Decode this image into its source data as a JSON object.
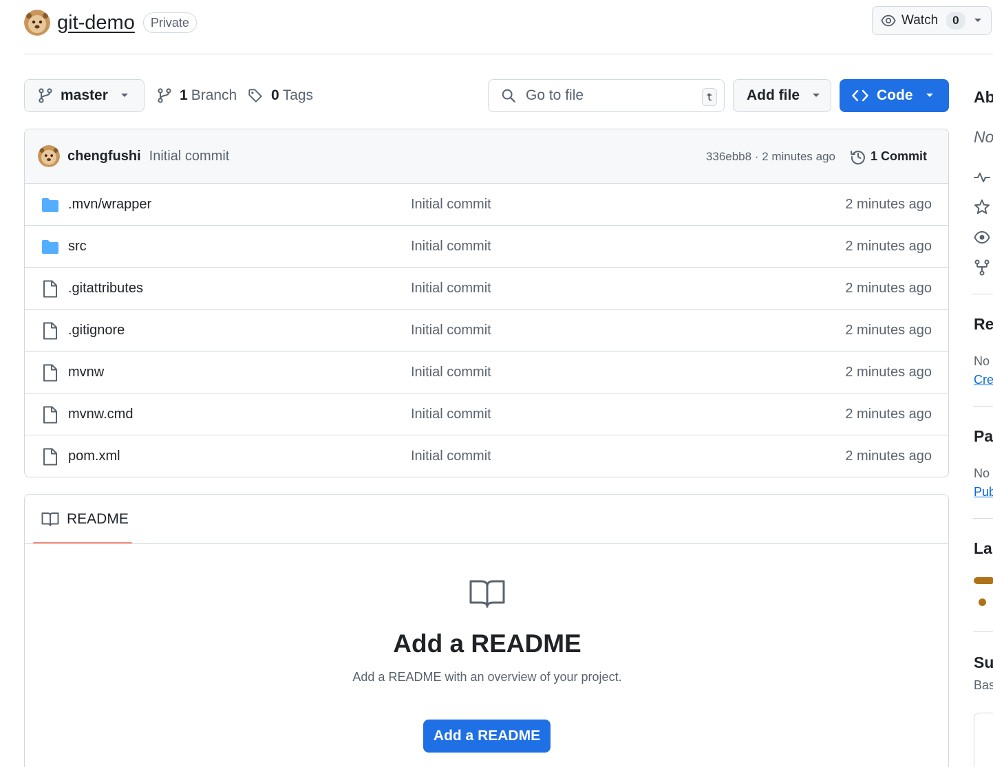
{
  "repo": {
    "name": "git-demo",
    "visibility": "Private",
    "owner_avatar_icon": "otter-avatar-icon"
  },
  "watch": {
    "label": "Watch",
    "count": "0"
  },
  "toolbar": {
    "branch_name": "master",
    "branch_count": "1",
    "branch_label": "Branch",
    "tag_count": "0",
    "tag_label": "Tags",
    "search_placeholder": "Go to file",
    "search_shortcut": "t",
    "add_file_label": "Add file",
    "code_label": "Code"
  },
  "latest_commit": {
    "author": "chengfushi",
    "message": "Initial commit",
    "meta": "336ebb8 · 2 minutes ago",
    "count": "1",
    "count_label": "Commit"
  },
  "files": [
    {
      "name": ".mvn/wrapper",
      "type": "folder",
      "commit": "Initial commit",
      "time": "2 minutes ago"
    },
    {
      "name": "src",
      "type": "folder",
      "commit": "Initial commit",
      "time": "2 minutes ago"
    },
    {
      "name": ".gitattributes",
      "type": "file",
      "commit": "Initial commit",
      "time": "2 minutes ago"
    },
    {
      "name": ".gitignore",
      "type": "file",
      "commit": "Initial commit",
      "time": "2 minutes ago"
    },
    {
      "name": "mvnw",
      "type": "file",
      "commit": "Initial commit",
      "time": "2 minutes ago"
    },
    {
      "name": "mvnw.cmd",
      "type": "file",
      "commit": "Initial commit",
      "time": "2 minutes ago"
    },
    {
      "name": "pom.xml",
      "type": "file",
      "commit": "Initial commit",
      "time": "2 minutes ago"
    }
  ],
  "readme": {
    "tab_label": "README",
    "title": "Add a README",
    "description": "Add a README with an overview of your project.",
    "button_label": "Add a README"
  },
  "sidebar": {
    "about_heading": "Ab",
    "about_text": "No",
    "releases_heading": "Re",
    "releases_text": "No",
    "releases_link": "Cre",
    "packages_heading": "Pa",
    "packages_text": "No",
    "packages_link": "Pub",
    "languages_heading": "La",
    "suggested_heading": "Su",
    "suggested_text": "Bas"
  },
  "colors": {
    "primary_button": "#1f6fe5",
    "folder_icon": "#54aeff",
    "tab_underline": "#fd8c73",
    "language_java": "#b07219",
    "link": "#0969da"
  }
}
